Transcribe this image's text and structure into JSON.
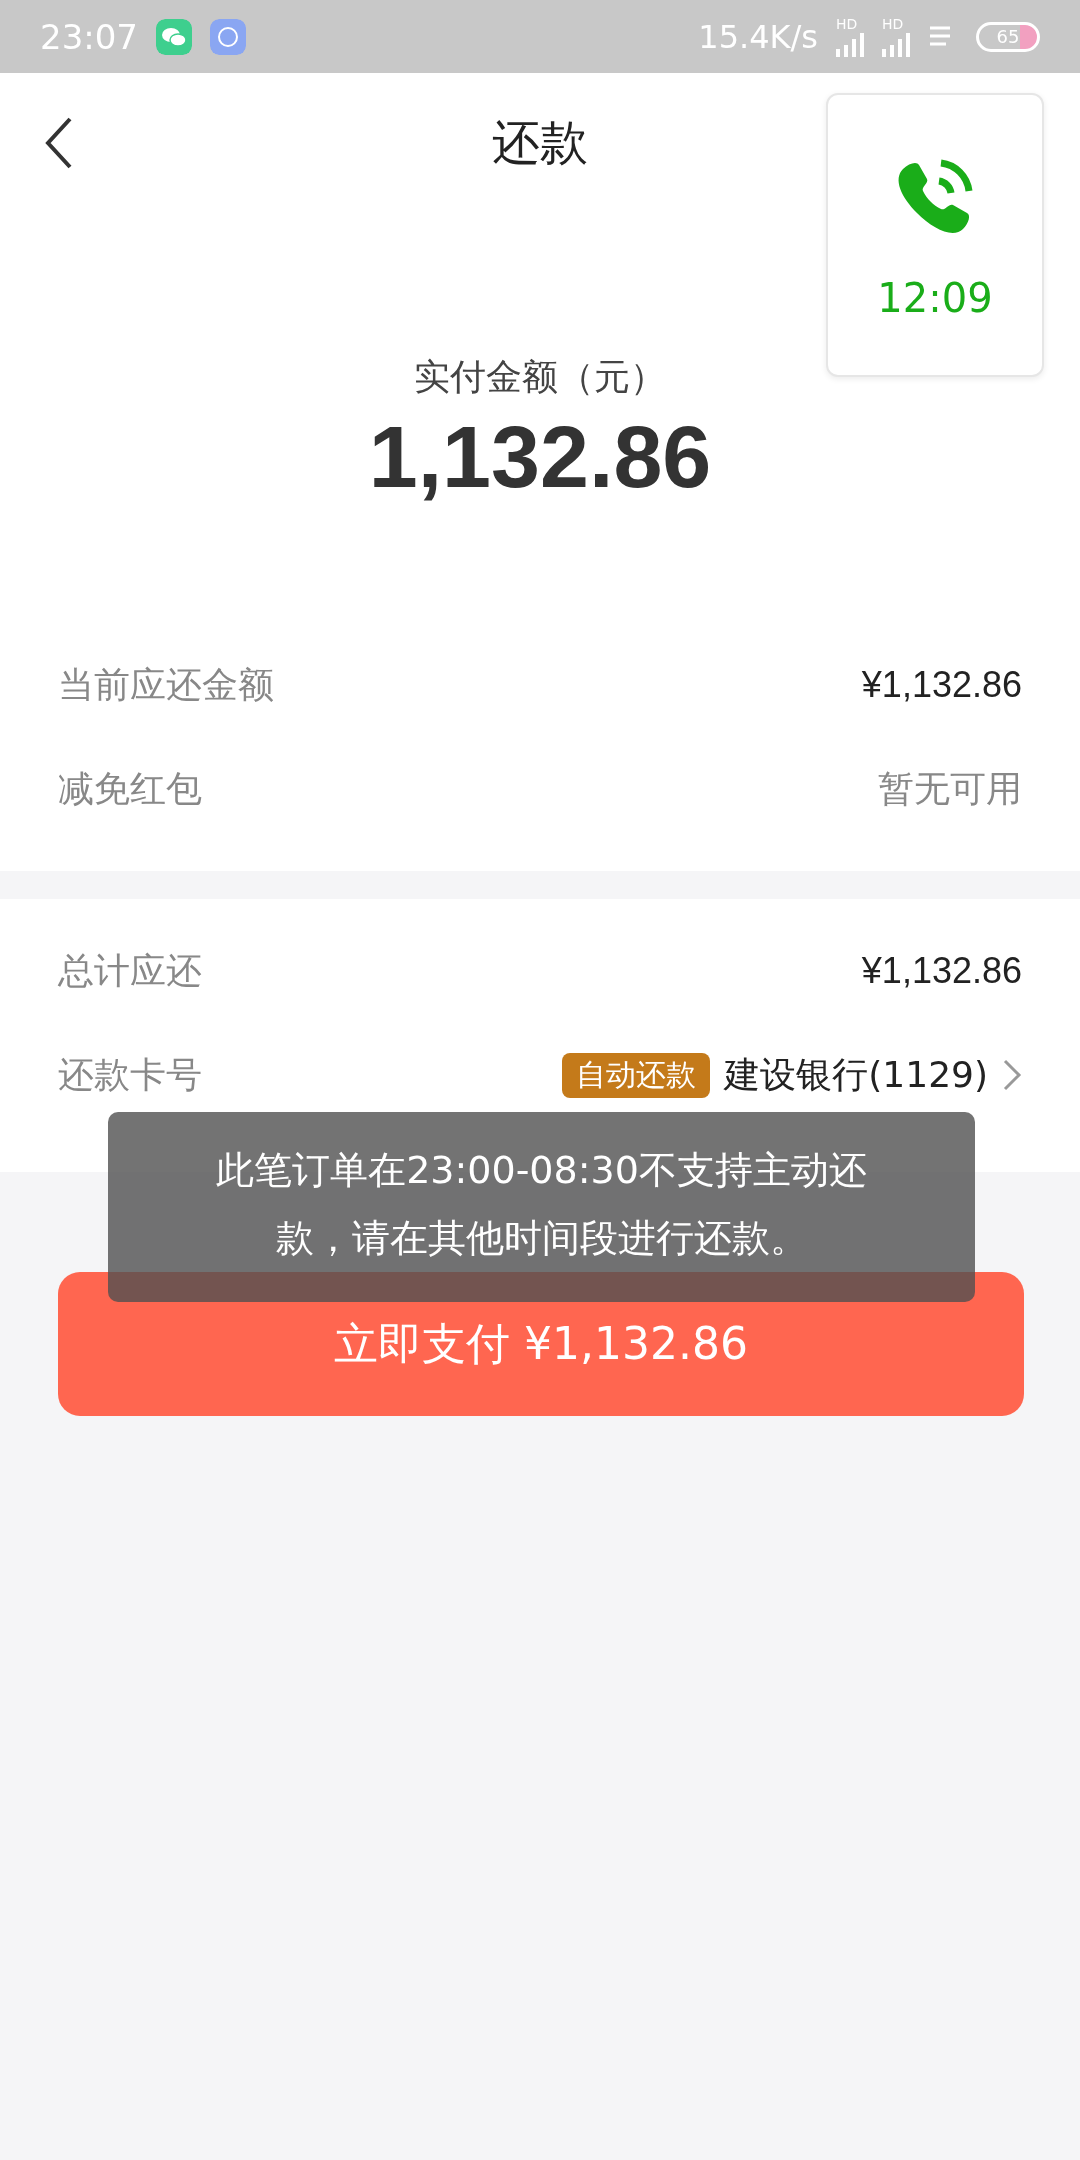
{
  "status_bar": {
    "time": "23:07",
    "network_speed": "15.4K/s",
    "signals": [
      {
        "label": "HD"
      },
      {
        "label": "HD"
      }
    ],
    "battery": "65"
  },
  "header": {
    "title": "还款"
  },
  "call_widget": {
    "time": "12:09"
  },
  "amount": {
    "label": "实付金额（元）",
    "value": "1,132.86"
  },
  "section_1": [
    {
      "label": "当前应还金额",
      "value": "¥1,132.86",
      "kind": "strong"
    },
    {
      "label": "减免红包",
      "value": "暂无可用",
      "kind": "muted"
    }
  ],
  "section_2": {
    "total": {
      "label": "总计应还",
      "value": "¥1,132.86"
    },
    "card": {
      "label": "还款卡号",
      "tag": "自动还款",
      "bank": "建设银行(1129)"
    }
  },
  "toast": "此笔订单在23:00-08:30不支持主动还款，请在其他时间段进行还款。",
  "pay_button": "立即支付 ¥1,132.86"
}
